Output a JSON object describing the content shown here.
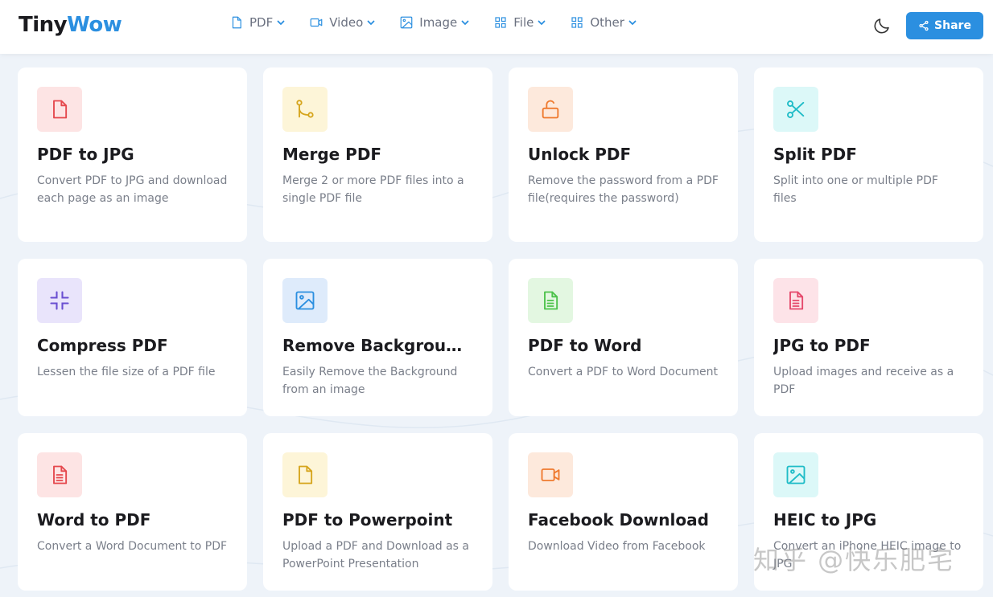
{
  "brand": {
    "part1": "Tiny",
    "part2": "Wow",
    "accent": "#2b8fe0"
  },
  "nav": [
    {
      "label": "PDF",
      "icon": "file-icon"
    },
    {
      "label": "Video",
      "icon": "video-icon"
    },
    {
      "label": "Image",
      "icon": "image-icon"
    },
    {
      "label": "File",
      "icon": "grid-icon"
    },
    {
      "label": "Other",
      "icon": "grid-icon"
    }
  ],
  "header": {
    "share_label": "Share",
    "theme_icon": "moon-icon"
  },
  "tools": [
    {
      "title": "PDF to JPG",
      "desc": "Convert PDF to JPG and download each page as an image",
      "icon": "file-icon",
      "bg": "#fde4e4",
      "color": "#e5484d"
    },
    {
      "title": "Merge PDF",
      "desc": "Merge 2 or more PDF files into a single PDF file",
      "icon": "merge-icon",
      "bg": "#fdf5d8",
      "color": "#d6a51d"
    },
    {
      "title": "Unlock PDF",
      "desc": "Remove the password from a PDF file(requires the password)",
      "icon": "unlock-icon",
      "bg": "#fde9dc",
      "color": "#ef7a2f"
    },
    {
      "title": "Split PDF",
      "desc": "Split into one or multiple PDF files",
      "icon": "scissors-icon",
      "bg": "#dcf8f8",
      "color": "#1fbcc7"
    },
    {
      "title": "Compress PDF",
      "desc": "Lessen the file size of a PDF file",
      "icon": "compress-icon",
      "bg": "#e9e4fb",
      "color": "#6a4fd1"
    },
    {
      "title": "Remove Background from Image",
      "desc": "Easily Remove the Background from an image",
      "icon": "image-icon",
      "bg": "#deebfb",
      "color": "#2b8fe0"
    },
    {
      "title": "PDF to Word",
      "desc": "Convert a PDF to Word Document",
      "icon": "document-icon",
      "bg": "#e3f7e1",
      "color": "#4cc24a"
    },
    {
      "title": "JPG to PDF",
      "desc": "Upload images and receive as a PDF",
      "icon": "document-icon",
      "bg": "#fde3e8",
      "color": "#e5486b"
    },
    {
      "title": "Word to PDF",
      "desc": "Convert a Word Document to PDF",
      "icon": "document-icon",
      "bg": "#fde4e4",
      "color": "#e5484d"
    },
    {
      "title": "PDF to Powerpoint",
      "desc": "Upload a PDF and Download as a PowerPoint Presentation",
      "icon": "file-icon",
      "bg": "#fdf5d8",
      "color": "#d6a51d"
    },
    {
      "title": "Facebook Download",
      "desc": "Download Video from Facebook",
      "icon": "video-icon",
      "bg": "#fde9dc",
      "color": "#ef7a2f"
    },
    {
      "title": "HEIC to JPG",
      "desc": "Convert an iPhone HEIC image to JPG",
      "icon": "image-icon",
      "bg": "#dcf8f8",
      "color": "#1fbcc7"
    }
  ],
  "watermark": "知乎 @快乐肥宅"
}
